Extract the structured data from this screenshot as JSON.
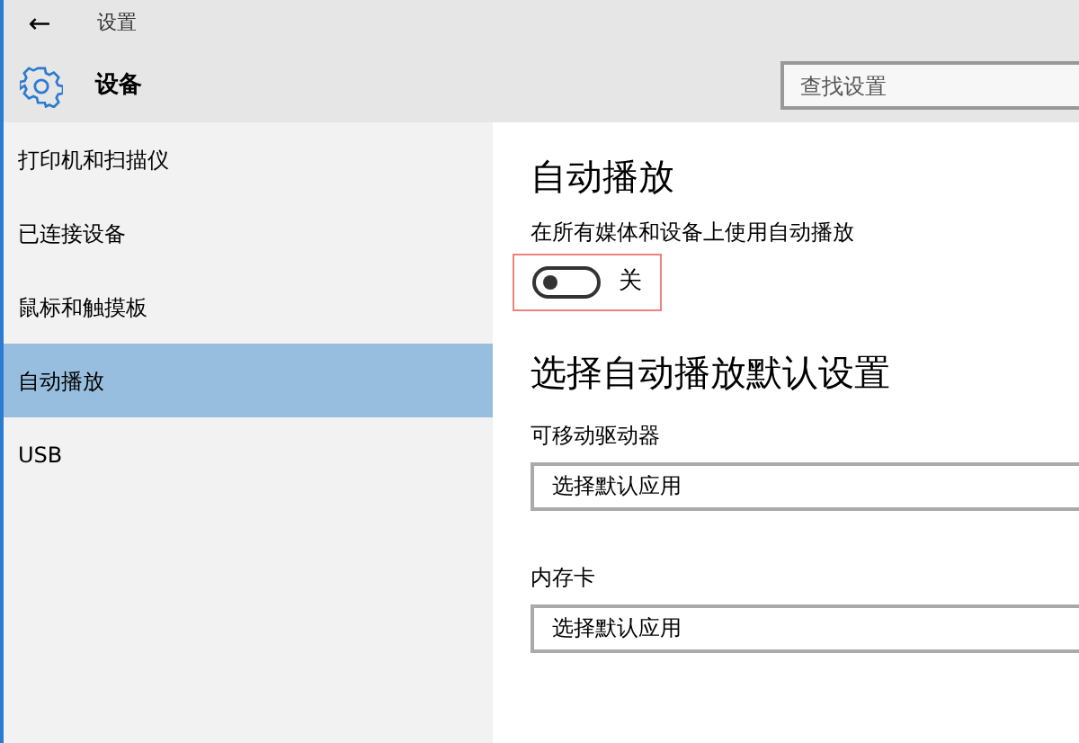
{
  "window": {
    "title": "设置",
    "back": "←"
  },
  "header": {
    "title": "设备",
    "search": {
      "placeholder": "查找设置"
    }
  },
  "sidebar": {
    "items": [
      {
        "label": "打印机和扫描仪",
        "selected": false
      },
      {
        "label": "已连接设备",
        "selected": false
      },
      {
        "label": "鼠标和触摸板",
        "selected": false
      },
      {
        "label": "自动播放",
        "selected": true
      },
      {
        "label": "USB",
        "selected": false
      }
    ]
  },
  "content": {
    "title": "自动播放",
    "toggle": {
      "label": "在所有媒体和设备上使用自动播放",
      "on": false,
      "state_text": "关",
      "highlighted": true
    },
    "section_title": "选择自动播放默认设置",
    "selects": [
      {
        "label": "可移动驱动器",
        "value": "选择默认应用"
      },
      {
        "label": "内存卡",
        "value": "选择默认应用"
      }
    ]
  }
}
